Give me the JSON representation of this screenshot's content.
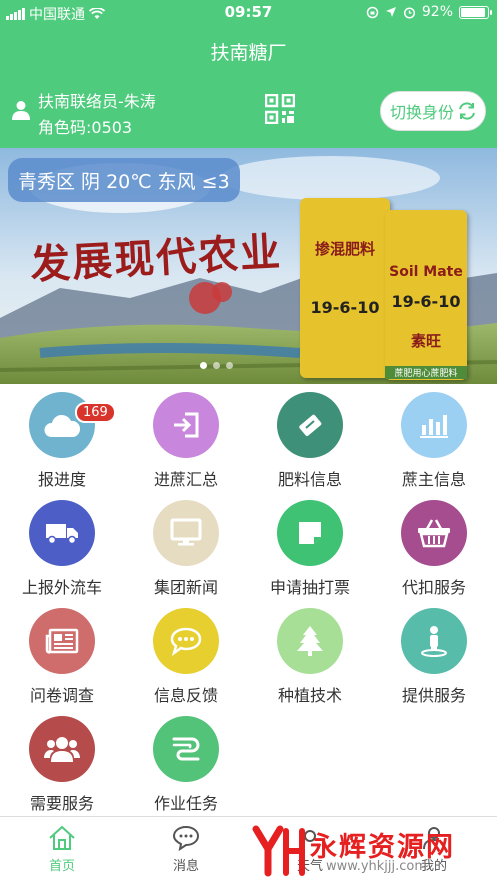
{
  "status_bar": {
    "carrier": "中国联通",
    "time": "09:57",
    "battery": "92%",
    "battery_level": 0.92
  },
  "header": {
    "title": "扶南糖厂",
    "user_name": "扶南联络员-朱涛",
    "role_code": "角色码:0503",
    "switch_button": "切换身份"
  },
  "banner": {
    "weather": "青秀区 阴 20℃ 东风 ≤3",
    "slogan": "发展现代农业",
    "bag_left_title": "掺混肥料",
    "bag_left_formula": "19-6-10",
    "bag_right_brand": "Soil Mate",
    "bag_right_formula": "19-6-10",
    "bag_right_brand_cn": "素旺",
    "bottom_strip": "蔗肥用心蔗肥料"
  },
  "grid": {
    "items": [
      {
        "label": "报进度",
        "icon": "cloud-icon",
        "color": "#6fb3cf",
        "badge": "169"
      },
      {
        "label": "进蔗汇总",
        "icon": "login-icon",
        "color": "#c887dc"
      },
      {
        "label": "肥料信息",
        "icon": "ticket-icon",
        "color": "#3f9079"
      },
      {
        "label": "蔗主信息",
        "icon": "bar-chart-icon",
        "color": "#9cd0f2"
      },
      {
        "label": "上报外流车",
        "icon": "truck-icon",
        "color": "#4d5fc7"
      },
      {
        "label": "集团新闻",
        "icon": "monitor-icon",
        "color": "#e5dcc1"
      },
      {
        "label": "申请抽打票",
        "icon": "note-icon",
        "color": "#3fc273"
      },
      {
        "label": "代扣服务",
        "icon": "basket-icon",
        "color": "#a54d8e"
      },
      {
        "label": "问卷调查",
        "icon": "newspaper-icon",
        "color": "#cf6c6c"
      },
      {
        "label": "信息反馈",
        "icon": "chat-bubble-icon",
        "color": "#e6cf2e"
      },
      {
        "label": "种植技术",
        "icon": "tree-icon",
        "color": "#a8df97"
      },
      {
        "label": "提供服务",
        "icon": "person-pin-icon",
        "color": "#57bca9"
      },
      {
        "label": "需要服务",
        "icon": "group-icon",
        "color": "#b54b4b"
      },
      {
        "label": "作业任务",
        "icon": "route-icon",
        "color": "#54c37a"
      }
    ]
  },
  "tabbar": {
    "items": [
      {
        "label": "首页",
        "icon": "home-icon"
      },
      {
        "label": "消息",
        "icon": "message-icon"
      },
      {
        "label": "天气",
        "icon": "weather-icon"
      },
      {
        "label": "我的",
        "icon": "profile-icon"
      }
    ]
  },
  "watermark": {
    "text": "永辉资源网",
    "url": "www.yhkjjj.com"
  },
  "colors": {
    "brand_green": "#4ecb7d",
    "badge_red": "#d9342b"
  }
}
